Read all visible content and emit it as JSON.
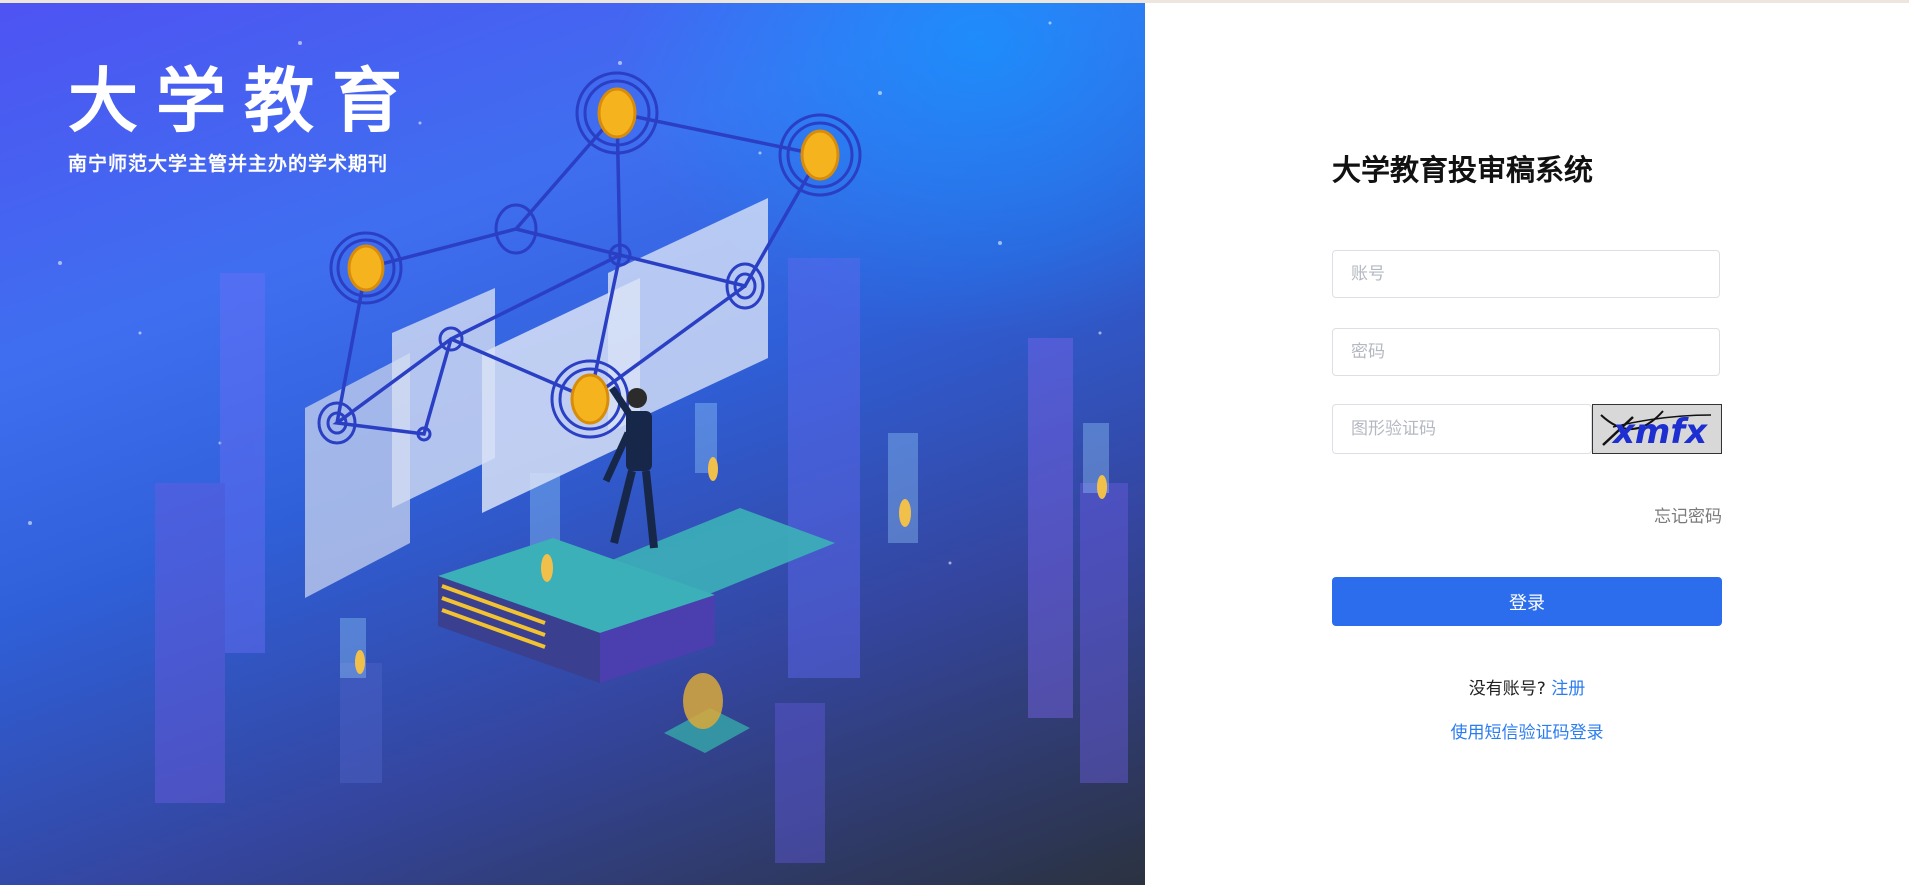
{
  "brand": {
    "title": "大学教育",
    "subtitle": "南宁师范大学主管并主办的学术期刊"
  },
  "login": {
    "title": "大学教育投审稿系统",
    "account_placeholder": "账号",
    "password_placeholder": "密码",
    "captcha_placeholder": "图形验证码",
    "captcha_text": "xmfx",
    "forgot_password": "忘记密码",
    "submit_label": "登录",
    "no_account_text": "没有账号?",
    "register_link": "注册",
    "sms_login_link": "使用短信验证码登录"
  },
  "colors": {
    "primary": "#2b6ded",
    "link": "#2b7cf0",
    "hero_start": "#4e53f2",
    "hero_end": "#2b3240"
  }
}
